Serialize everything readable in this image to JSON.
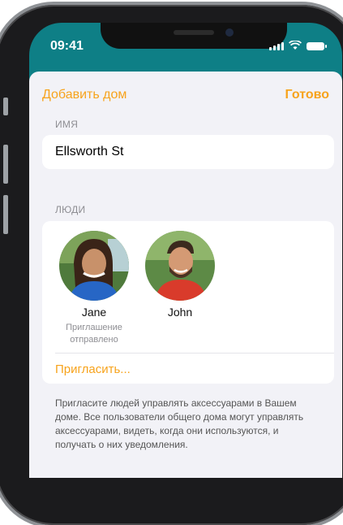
{
  "status_bar": {
    "time": "09:41"
  },
  "nav": {
    "add_home": "Добавить дом",
    "done": "Готово"
  },
  "name_section": {
    "label": "ИМЯ",
    "value": "Ellsworth St"
  },
  "people_section": {
    "label": "ЛЮДИ",
    "people": [
      {
        "name": "Jane",
        "status": "Приглашение отправлено"
      },
      {
        "name": "John",
        "status": ""
      }
    ],
    "invite": "Пригласить..."
  },
  "footer_note": "Пригласите людей управлять аксессуарами в Вашем доме. Все пользователи общего дома могут управлять аксессуарами, видеть, когда они используются, и получать о них уведомления.",
  "colors": {
    "accent": "#f7a31c",
    "header_bg": "#0e7f86",
    "sheet_bg": "#f2f2f7"
  }
}
